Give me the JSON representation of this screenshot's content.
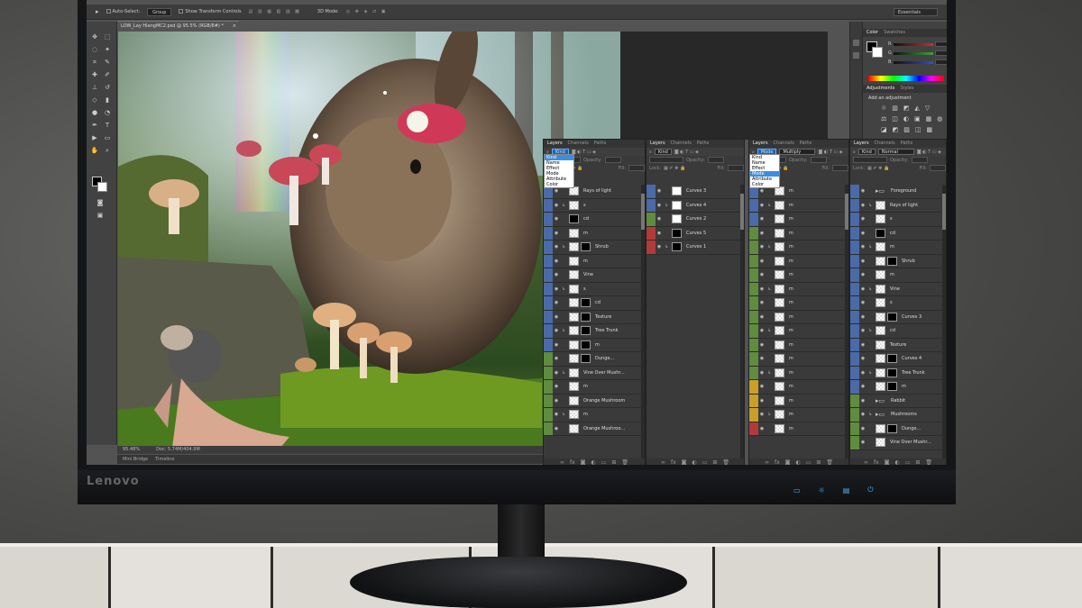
{
  "brand": "Lenovo",
  "options_bar": {
    "auto_select": "Auto-Select:",
    "group": "Group",
    "show_transform": "Show Transform Controls",
    "mode_3d": "3D Mode:",
    "workspace": "Essentials"
  },
  "document": {
    "tab_title": "LOW_Lay HiangMC2.psd @ 95.5% (RGB/8#) *",
    "close": "×",
    "zoom": "95.48%",
    "doc_size": "Doc: 5.74M/404.9M",
    "bottom_tabs": [
      "Mini Bridge",
      "Timeline"
    ]
  },
  "color_panel": {
    "tabs": [
      "Color",
      "Swatches"
    ],
    "channels": [
      "R",
      "G",
      "B"
    ],
    "colors": {
      "r": "#c8302a",
      "g": "#3aa03a",
      "b": "#3050c0"
    }
  },
  "adjustments_panel": {
    "tabs": [
      "Adjustments",
      "Styles"
    ],
    "heading": "Add an adjustment",
    "rows": [
      [
        "☼",
        "▥",
        "◩",
        "◭",
        "▽"
      ],
      [
        "⚖",
        "◫",
        "◐",
        "▣",
        "▦",
        "◍"
      ],
      [
        "◪",
        "◩",
        "▨",
        "◫",
        "▩"
      ]
    ]
  },
  "layers_panels": [
    {
      "tabs": [
        "Layers",
        "Channels",
        "Paths"
      ],
      "filter": "Kind",
      "dropdown": [
        "Kind",
        "Name",
        "Effect",
        "Mode",
        "Attribute",
        "Color"
      ],
      "dropdown_selected": 0,
      "opacity": "Opacity:",
      "lock": "Lock:",
      "fill": "Fill:",
      "layers": [
        {
          "name": "Rays of light",
          "color": "blue",
          "thumb": "chk"
        },
        {
          "name": "s",
          "color": "blue",
          "thumb": "chk"
        },
        {
          "name": "cd",
          "color": "blue",
          "thumb": "blk"
        },
        {
          "name": "m",
          "color": "blue",
          "thumb": "chk"
        },
        {
          "name": "Shrub",
          "color": "blue",
          "thumb": "img",
          "mask": true
        },
        {
          "name": "m",
          "color": "blue",
          "thumb": "chk"
        },
        {
          "name": "Vine",
          "color": "blue",
          "thumb": "chk"
        },
        {
          "name": "s",
          "color": "blue",
          "thumb": "chk"
        },
        {
          "name": "cd",
          "color": "blue",
          "thumb": "chk",
          "mask": true
        },
        {
          "name": "Texture",
          "color": "blue",
          "thumb": "chk",
          "mask": true
        },
        {
          "name": "Tree Trunk",
          "color": "blue",
          "thumb": "img",
          "mask": true
        },
        {
          "name": "m",
          "color": "blue",
          "thumb": "chk",
          "mask": true
        },
        {
          "name": "Dunge...",
          "color": "green",
          "thumb": "chk",
          "mask": true
        },
        {
          "name": "Vine Over Mushr...",
          "color": "green",
          "thumb": "chk"
        },
        {
          "name": "m",
          "color": "green",
          "thumb": "chk"
        },
        {
          "name": "Orange Mushroom",
          "color": "green",
          "thumb": "chk"
        },
        {
          "name": "m",
          "color": "green",
          "thumb": "chk"
        },
        {
          "name": "Orange Mushroo...",
          "color": "green",
          "thumb": "chk"
        }
      ]
    },
    {
      "tabs": [
        "Layers",
        "Channels",
        "Paths"
      ],
      "filter": "Kind",
      "opacity": "Opacity:",
      "lock": "Lock:",
      "fill": "Fill:",
      "layers": [
        {
          "name": "Curves 3",
          "color": "blue",
          "thumb": "wht"
        },
        {
          "name": "Curves 4",
          "color": "blue",
          "thumb": "wht"
        },
        {
          "name": "Curves 2",
          "color": "green",
          "thumb": "wht"
        },
        {
          "name": "Curves 5",
          "color": "red",
          "thumb": "blk"
        },
        {
          "name": "Curves 1",
          "color": "red",
          "thumb": "blk"
        }
      ]
    },
    {
      "tabs": [
        "Layers",
        "Channels",
        "Paths"
      ],
      "filter": "Mode",
      "blend": "Multiply",
      "dropdown": [
        "Kind",
        "Name",
        "Effect",
        "Mode",
        "Attribute",
        "Color"
      ],
      "dropdown_selected": 3,
      "opacity": "Opacity:",
      "lock": "Lock:",
      "fill": "Fill:",
      "layers": [
        {
          "name": "m",
          "color": "blue",
          "thumb": "chk"
        },
        {
          "name": "m",
          "color": "blue",
          "thumb": "chk"
        },
        {
          "name": "m",
          "color": "blue",
          "thumb": "chk"
        },
        {
          "name": "m",
          "color": "green",
          "thumb": "chk"
        },
        {
          "name": "m",
          "color": "green",
          "thumb": "chk"
        },
        {
          "name": "m",
          "color": "green",
          "thumb": "chk"
        },
        {
          "name": "m",
          "color": "green",
          "thumb": "chk"
        },
        {
          "name": "m",
          "color": "green",
          "thumb": "chk"
        },
        {
          "name": "m",
          "color": "green",
          "thumb": "chk"
        },
        {
          "name": "m",
          "color": "green",
          "thumb": "chk"
        },
        {
          "name": "m",
          "color": "green",
          "thumb": "chk"
        },
        {
          "name": "m",
          "color": "green",
          "thumb": "chk"
        },
        {
          "name": "m",
          "color": "green",
          "thumb": "chk"
        },
        {
          "name": "m",
          "color": "green",
          "thumb": "chk"
        },
        {
          "name": "m",
          "color": "yellow",
          "thumb": "chk"
        },
        {
          "name": "m",
          "color": "yellow",
          "thumb": "chk"
        },
        {
          "name": "m",
          "color": "yellow",
          "thumb": "chk"
        },
        {
          "name": "m",
          "color": "red",
          "thumb": "chk"
        }
      ]
    },
    {
      "tabs": [
        "Layers",
        "Channels",
        "Paths"
      ],
      "filter": "Kind",
      "blend": "Normal",
      "opacity": "Opacity:",
      "lock": "Lock:",
      "fill": "Fill:",
      "layers": [
        {
          "name": "Foreground",
          "color": "blue",
          "thumb": "fld"
        },
        {
          "name": "Rays of light",
          "color": "blue",
          "thumb": "chk"
        },
        {
          "name": "s",
          "color": "blue",
          "thumb": "chk"
        },
        {
          "name": "cd",
          "color": "blue",
          "thumb": "blk"
        },
        {
          "name": "m",
          "color": "blue",
          "thumb": "chk"
        },
        {
          "name": "Shrub",
          "color": "blue",
          "thumb": "img",
          "mask": true
        },
        {
          "name": "m",
          "color": "blue",
          "thumb": "chk"
        },
        {
          "name": "Vine",
          "color": "blue",
          "thumb": "chk"
        },
        {
          "name": "s",
          "color": "blue",
          "thumb": "chk"
        },
        {
          "name": "Curves 3",
          "color": "blue",
          "thumb": "chk",
          "mask": true
        },
        {
          "name": "cd",
          "color": "blue",
          "thumb": "chk"
        },
        {
          "name": "Texture",
          "color": "blue",
          "thumb": "chk"
        },
        {
          "name": "Curves 4",
          "color": "blue",
          "thumb": "chk",
          "mask": true
        },
        {
          "name": "Tree Trunk",
          "color": "blue",
          "thumb": "img",
          "mask": true
        },
        {
          "name": "m",
          "color": "blue",
          "thumb": "chk",
          "mask": true
        },
        {
          "name": "Rabbit",
          "color": "green",
          "thumb": "fld"
        },
        {
          "name": "Mushrooms",
          "color": "green",
          "thumb": "fld"
        },
        {
          "name": "Dunge...",
          "color": "green",
          "thumb": "chk",
          "mask": true
        },
        {
          "name": "Vine Over Mushr...",
          "color": "green",
          "thumb": "chk"
        }
      ]
    }
  ],
  "panel_footer": [
    "∞",
    "fx",
    "◙",
    "◐",
    "▭",
    "⊞",
    "🗑"
  ]
}
